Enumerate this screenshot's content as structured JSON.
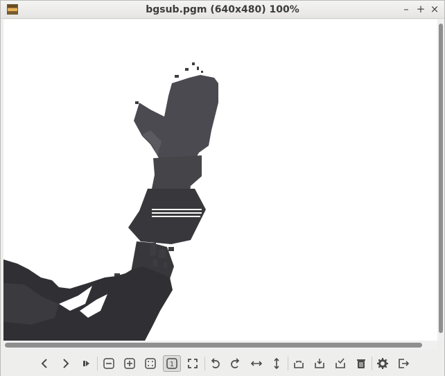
{
  "window": {
    "title": "bgsub.pgm (640x480) 100%",
    "controls": {
      "minimize": "–",
      "maximize": "+",
      "close": "×"
    }
  },
  "image": {
    "filename": "bgsub.pgm",
    "width": 640,
    "height": 480,
    "zoom": "100%",
    "background_color": "#ffffff",
    "foreground_color": "#3e3e42"
  },
  "toolbar": {
    "icons": [
      "previous-icon",
      "next-icon",
      "slideshow-icon",
      "zoom-out-icon",
      "zoom-in-icon",
      "zoom-fit-icon",
      "zoom-actual-size-icon",
      "fullscreen-icon",
      "rotate-left-icon",
      "rotate-right-icon",
      "flip-horizontal-icon",
      "flip-vertical-icon",
      "open-icon",
      "save-icon",
      "save-as-icon",
      "delete-icon",
      "preferences-icon",
      "quit-icon"
    ],
    "zoom_actual_label": "1"
  },
  "colors": {
    "titlebar_text": "#3c3c3c",
    "icon": "#4a4a4a",
    "scrollbar_thumb": "#8f8f8f"
  }
}
